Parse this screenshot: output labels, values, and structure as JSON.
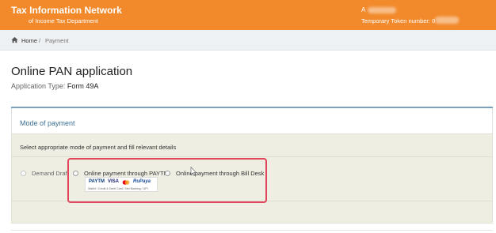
{
  "header": {
    "brand_line1": "Tax Information Network",
    "brand_line2": "of Income Tax Department",
    "user_initial": "A",
    "token_label": "Temporary Token number: 0",
    "background_color": "#f28a2c"
  },
  "breadcrumb": {
    "home_label": "Home",
    "separator": "/",
    "current_label": "Payment"
  },
  "page": {
    "title": "Online PAN application",
    "application_type_label": "Application Type:",
    "application_type_value": "Form 49A"
  },
  "payment_section": {
    "title": "Mode of payment",
    "instruction": "Select appropriate mode of payment and fill relevant details",
    "options": [
      {
        "label": "Demand Draft",
        "selected": false
      },
      {
        "label": "Online payment through PAYTM",
        "selected": false
      },
      {
        "label": "Online payment through Bill Desk",
        "selected": false
      }
    ],
    "paytm_logos": {
      "paytm": "PAYTM",
      "visa": "VISA",
      "rupay": "RuPaya",
      "fine_print": "Wallet / Credit & Debit Card / Net Banking / UPI"
    },
    "highlight_color": "#e0455a"
  }
}
